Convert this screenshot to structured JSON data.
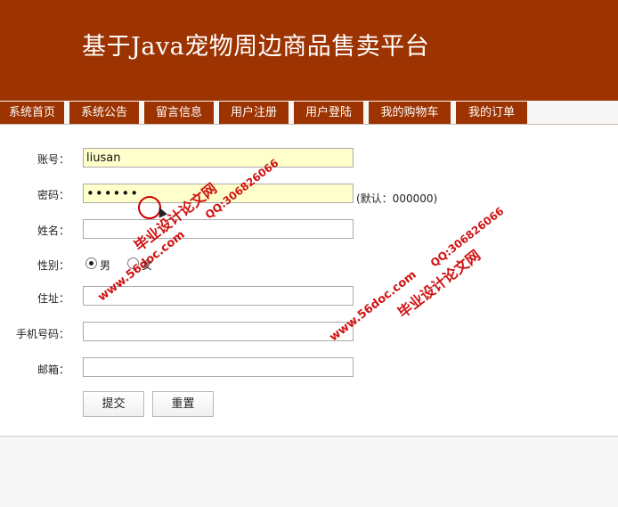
{
  "site": {
    "title": "基于Java宠物周边商品售卖平台"
  },
  "nav": {
    "items": [
      {
        "id": "home",
        "label": "系统首页"
      },
      {
        "id": "notice",
        "label": "系统公告"
      },
      {
        "id": "messages",
        "label": "留言信息"
      },
      {
        "id": "register",
        "label": "用户注册"
      },
      {
        "id": "login",
        "label": "用户登陆"
      },
      {
        "id": "cart",
        "label": "我的购物车"
      },
      {
        "id": "orders",
        "label": "我的订单"
      }
    ]
  },
  "form": {
    "account_label": "账号：",
    "account_value": "liusan",
    "password_label": "密码：",
    "password_value": "••••••",
    "password_hint": "(默认：000000)",
    "name_label": "姓名：",
    "name_value": "",
    "gender_label": "性别：",
    "gender_male": "男",
    "gender_female": "女",
    "gender_selected": "男",
    "address_label": "住址：",
    "address_value": "",
    "phone_label": "手机号码：",
    "phone_value": "",
    "email_label": "邮箱：",
    "email_value": "",
    "submit_label": "提交",
    "reset_label": "重置"
  },
  "watermark": {
    "site_text": "毕业设计论文网",
    "url_text": "www.56doc.com",
    "qq_text": "QQ:306826066"
  },
  "colors": {
    "brand": "#9c3300",
    "filled_field": "#ffffcc",
    "watermark": "#cc0000"
  }
}
